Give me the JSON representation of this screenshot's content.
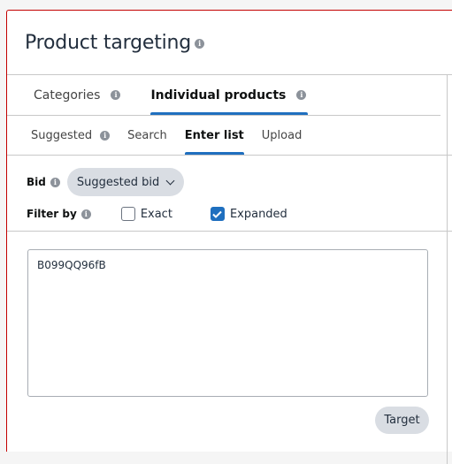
{
  "header": {
    "title": "Product targeting",
    "info_icon": "info-icon"
  },
  "main_tabs": [
    {
      "label": "Categories",
      "active": false,
      "info_icon": "info-icon"
    },
    {
      "label": "Individual products",
      "active": true,
      "info_icon": "info-icon"
    }
  ],
  "sub_tabs": [
    {
      "label": "Suggested",
      "active": false,
      "info_icon": "info-icon"
    },
    {
      "label": "Search",
      "active": false
    },
    {
      "label": "Enter list",
      "active": true
    },
    {
      "label": "Upload",
      "active": false
    }
  ],
  "bid": {
    "label": "Bid",
    "selected": "Suggested bid"
  },
  "filter": {
    "label": "Filter by",
    "options": [
      {
        "label": "Exact",
        "checked": false
      },
      {
        "label": "Expanded",
        "checked": true
      }
    ]
  },
  "list_input": {
    "value": "B099QQ96fB"
  },
  "target_button": {
    "label": "Target"
  },
  "colors": {
    "accent": "#1f6fbf",
    "border_highlight": "#c40000",
    "pill_bg": "#d9dde3"
  }
}
